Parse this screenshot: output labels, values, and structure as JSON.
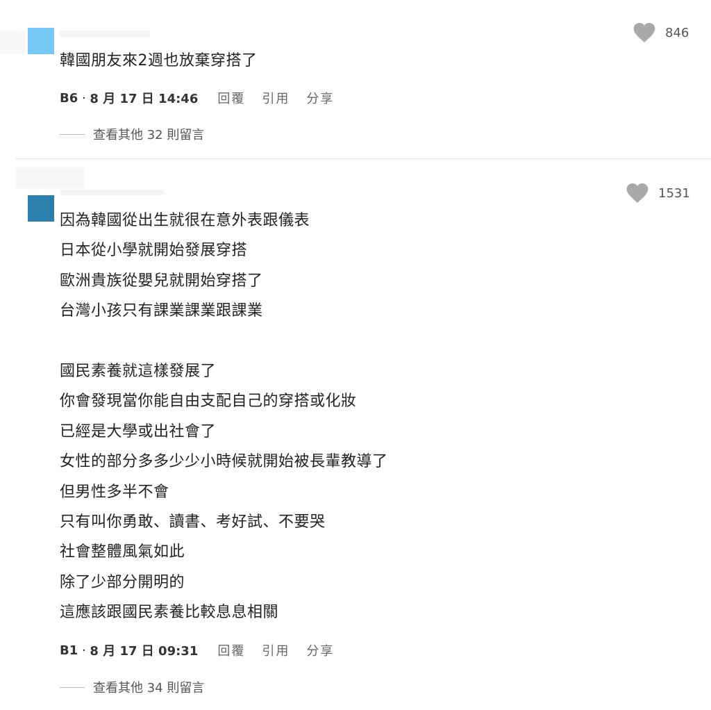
{
  "colors": {
    "avatar_b6": "#76c7f3",
    "avatar_b1": "#2b7fad",
    "heart": "#a9a9a9",
    "divider": "#e3e3e3"
  },
  "comments": [
    {
      "floor": "B6",
      "date": "8 月 17 日 14:46",
      "likes": "846",
      "lines": [
        "韓國朋友來2週也放棄穿搭了"
      ],
      "actions": [
        "回覆",
        "引用",
        "分享"
      ],
      "more_replies": "查看其他 32 則留言"
    },
    {
      "floor": "B1",
      "date": "8 月 17 日 09:31",
      "likes": "1531",
      "lines": [
        "因為韓國從出生就很在意外表跟儀表",
        "日本從小學就開始發展穿搭",
        "歐洲貴族從嬰兒就開始穿搭了",
        "台灣小孩只有課業課業跟課業",
        "",
        "國民素養就這樣發展了",
        "你會發現當你能自由支配自己的穿搭或化妝",
        "已經是大學或出社會了",
        "女性的部分多多少少小時候就開始被長輩教導了",
        "但男性多半不會",
        "只有叫你勇敢、讀書、考好試、不要哭",
        "社會整體風氣如此",
        "除了少部分開明的",
        "這應該跟國民素養比較息息相關"
      ],
      "actions": [
        "回覆",
        "引用",
        "分享"
      ],
      "more_replies": "查看其他 34 則留言"
    }
  ]
}
